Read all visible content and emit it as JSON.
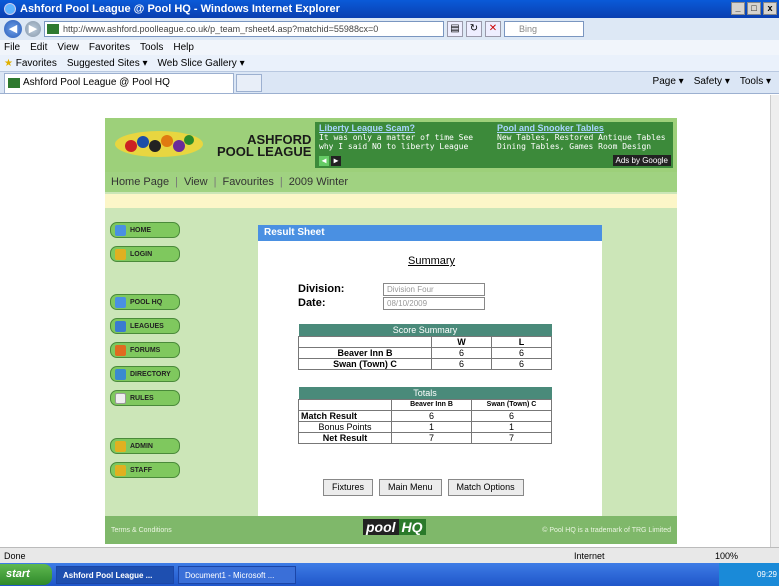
{
  "window": {
    "title": "Ashford Pool League @ Pool HQ - Windows Internet Explorer"
  },
  "address": {
    "url": "http://www.ashford.poolleague.co.uk/p_team_rsheet4.asp?matchid=55988cx=0",
    "search_placeholder": "Bing"
  },
  "menu": [
    "File",
    "Edit",
    "View",
    "Favorites",
    "Tools",
    "Help"
  ],
  "favorites": {
    "label": "Favorites",
    "items": [
      "Suggested Sites ▾",
      "Web Slice Gallery ▾"
    ]
  },
  "tab": {
    "title": "Ashford Pool League @ Pool HQ"
  },
  "commandbar": [
    "Page ▾",
    "Safety ▾",
    "Tools ▾"
  ],
  "site": {
    "brand_line1": "ASHFORD",
    "brand_line2": "POOL LEAGUE",
    "ad1_title": "Liberty League Scam?",
    "ad1_text": "It was only a matter of time See why I said NO to liberty League",
    "ad2_title": "Pool and Snooker Tables",
    "ad2_text": "New Tables, Restored Antique Tables Dining Tables, Games Room Design",
    "ads_by": "Ads by Google",
    "nav": [
      "Home Page",
      "View",
      "Favourites",
      "2009 Winter"
    ]
  },
  "leftnav": [
    "HOME",
    "LOGIN",
    "POOL HQ",
    "LEAGUES",
    "FORUMS",
    "DIRECTORY",
    "RULES",
    "ADMIN",
    "STAFF"
  ],
  "result": {
    "header": "Result Sheet",
    "summary": "Summary",
    "division_label": "Division:",
    "division_value": "Division Four",
    "date_label": "Date:",
    "date_value": "08/10/2009",
    "score_caption": "Score Summary",
    "w_label": "W",
    "l_label": "L",
    "score_rows": [
      {
        "team": "Beaver Inn B",
        "w": "6",
        "l": "6"
      },
      {
        "team": "Swan (Town) C",
        "w": "6",
        "l": "6"
      }
    ],
    "totals_caption": "Totals",
    "team1": "Beaver Inn B",
    "team2": "Swan (Town) C",
    "totals_rows": [
      {
        "label": "Match Result",
        "t1": "6",
        "t2": "6"
      },
      {
        "label": "Bonus Points",
        "t1": "1",
        "t2": "1"
      },
      {
        "label": "Net Result",
        "t1": "7",
        "t2": "7"
      }
    ],
    "buttons": [
      "Fixtures",
      "Main Menu",
      "Match Options"
    ]
  },
  "footer": {
    "terms": "Terms & Conditions",
    "logo_pool": "pool",
    "logo_hq": "HQ",
    "copyright": "© Pool HQ is a trademark of TRG Limited"
  },
  "status": {
    "text": "Done",
    "zone": "Internet",
    "zoom": "100%"
  },
  "taskbar": {
    "start": "start",
    "tasks": [
      "Ashford Pool League ...",
      "Document1 - Microsoft ..."
    ],
    "clock": "09:29"
  },
  "colors": {
    "site_bg": "#cce6b8",
    "header": "#9dd07a",
    "result_head": "#4a90e2",
    "table_caption": "#4a8a7a"
  }
}
